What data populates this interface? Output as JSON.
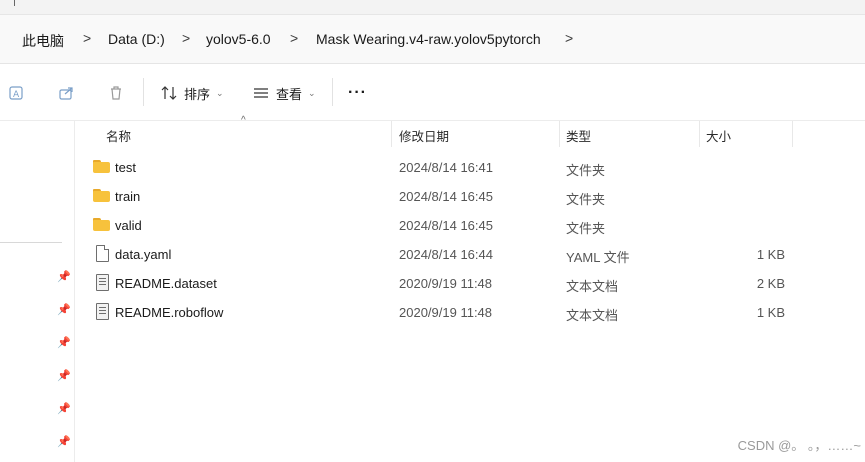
{
  "breadcrumb": {
    "items": [
      "此电脑",
      "Data (D:)",
      "yolov5-6.0",
      "Mask Wearing.v4-raw.yolov5pytorch"
    ],
    "separator": ">"
  },
  "toolbar": {
    "sort_label": "排序",
    "view_label": "查看",
    "more_label": "···"
  },
  "columns": {
    "name": "名称",
    "modified": "修改日期",
    "type": "类型",
    "size": "大小"
  },
  "files": [
    {
      "name": "test",
      "modified": "2024/8/14 16:41",
      "type": "文件夹",
      "size": "",
      "icon": "folder-icon"
    },
    {
      "name": "train",
      "modified": "2024/8/14 16:45",
      "type": "文件夹",
      "size": "",
      "icon": "folder-icon"
    },
    {
      "name": "valid",
      "modified": "2024/8/14 16:45",
      "type": "文件夹",
      "size": "",
      "icon": "folder-icon"
    },
    {
      "name": "data.yaml",
      "modified": "2024/8/14 16:44",
      "type": "YAML 文件",
      "size": "1 KB",
      "icon": "file-icon"
    },
    {
      "name": "README.dataset",
      "modified": "2020/9/19 11:48",
      "type": "文本文档",
      "size": "2 KB",
      "icon": "text-document-icon"
    },
    {
      "name": "README.roboflow",
      "modified": "2020/9/19 11:48",
      "type": "文本文档",
      "size": "1 KB",
      "icon": "text-document-icon"
    }
  ],
  "watermark": "CSDN @。 。，……~",
  "colors": {
    "folder": "#f7c23c",
    "folder_tab": "#e8a92a",
    "toolbar_icon": "#7a9fc8"
  }
}
